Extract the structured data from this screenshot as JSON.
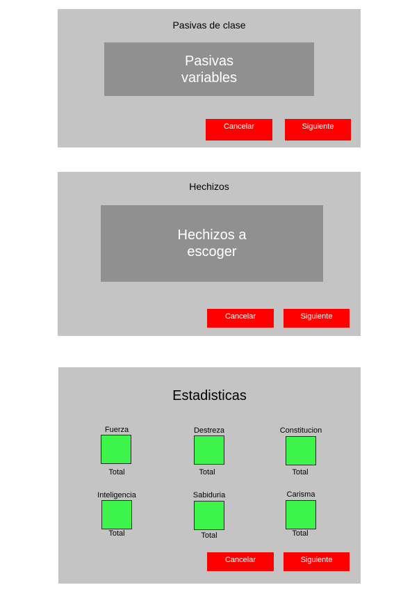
{
  "passives_panel": {
    "title": "Pasivas de clase",
    "placeholder": "Pasivas\nvariables",
    "cancel_label": "Cancelar",
    "next_label": "Siguiente"
  },
  "spells_panel": {
    "title": "Hechizos",
    "placeholder": "Hechizos a\nescoger",
    "cancel_label": "Cancelar",
    "next_label": "Siguiente"
  },
  "stats_panel": {
    "title": "Estadisticas",
    "stats": [
      {
        "name": "Fuerza",
        "total_label": "Total"
      },
      {
        "name": "Destreza",
        "total_label": "Total"
      },
      {
        "name": "Constitucion",
        "total_label": "Total"
      },
      {
        "name": "Inteligencia",
        "total_label": "Total"
      },
      {
        "name": "Sabiduria",
        "total_label": "Total"
      },
      {
        "name": "Carisma",
        "total_label": "Total"
      }
    ],
    "cancel_label": "Cancelar",
    "next_label": "Siguiente"
  },
  "colors": {
    "panel_background": "#c4c4c4",
    "placeholder_background": "#909090",
    "button_background": "#ff0000",
    "stat_box_fill": "#3df54a"
  }
}
